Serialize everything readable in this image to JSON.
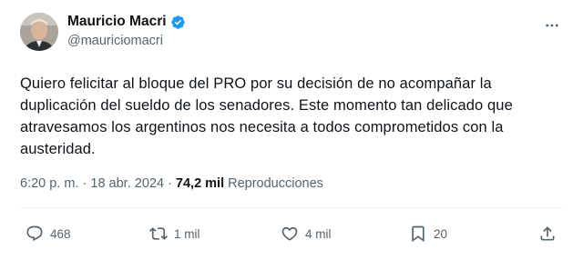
{
  "author": {
    "display_name": "Mauricio Macri",
    "handle": "@mauriciomacri",
    "verified": true,
    "verified_color": "#1d9bf0"
  },
  "tweet": {
    "text": "Quiero felicitar al bloque del PRO por su decisión de no acompañar la duplicación del sueldo de los senadores. Este momento tan delicado que atravesamos los argentinos nos necesita a todos comprometidos con la austeridad.",
    "time": "6:20 p. m.",
    "separator": "·",
    "date": "18 abr. 2024",
    "views_count": "74,2 mil",
    "views_label": "Reproducciones"
  },
  "actions": {
    "reply_count": "468",
    "retweet_count": "1 mil",
    "like_count": "4 mil",
    "bookmark_count": "20"
  },
  "icons": {
    "more": "more-dots-icon",
    "reply": "reply-icon",
    "retweet": "retweet-icon",
    "like": "heart-icon",
    "bookmark": "bookmark-icon",
    "share": "share-icon"
  },
  "colors": {
    "text": "#0f1419",
    "secondary": "#536471",
    "divider": "#eff3f4"
  }
}
